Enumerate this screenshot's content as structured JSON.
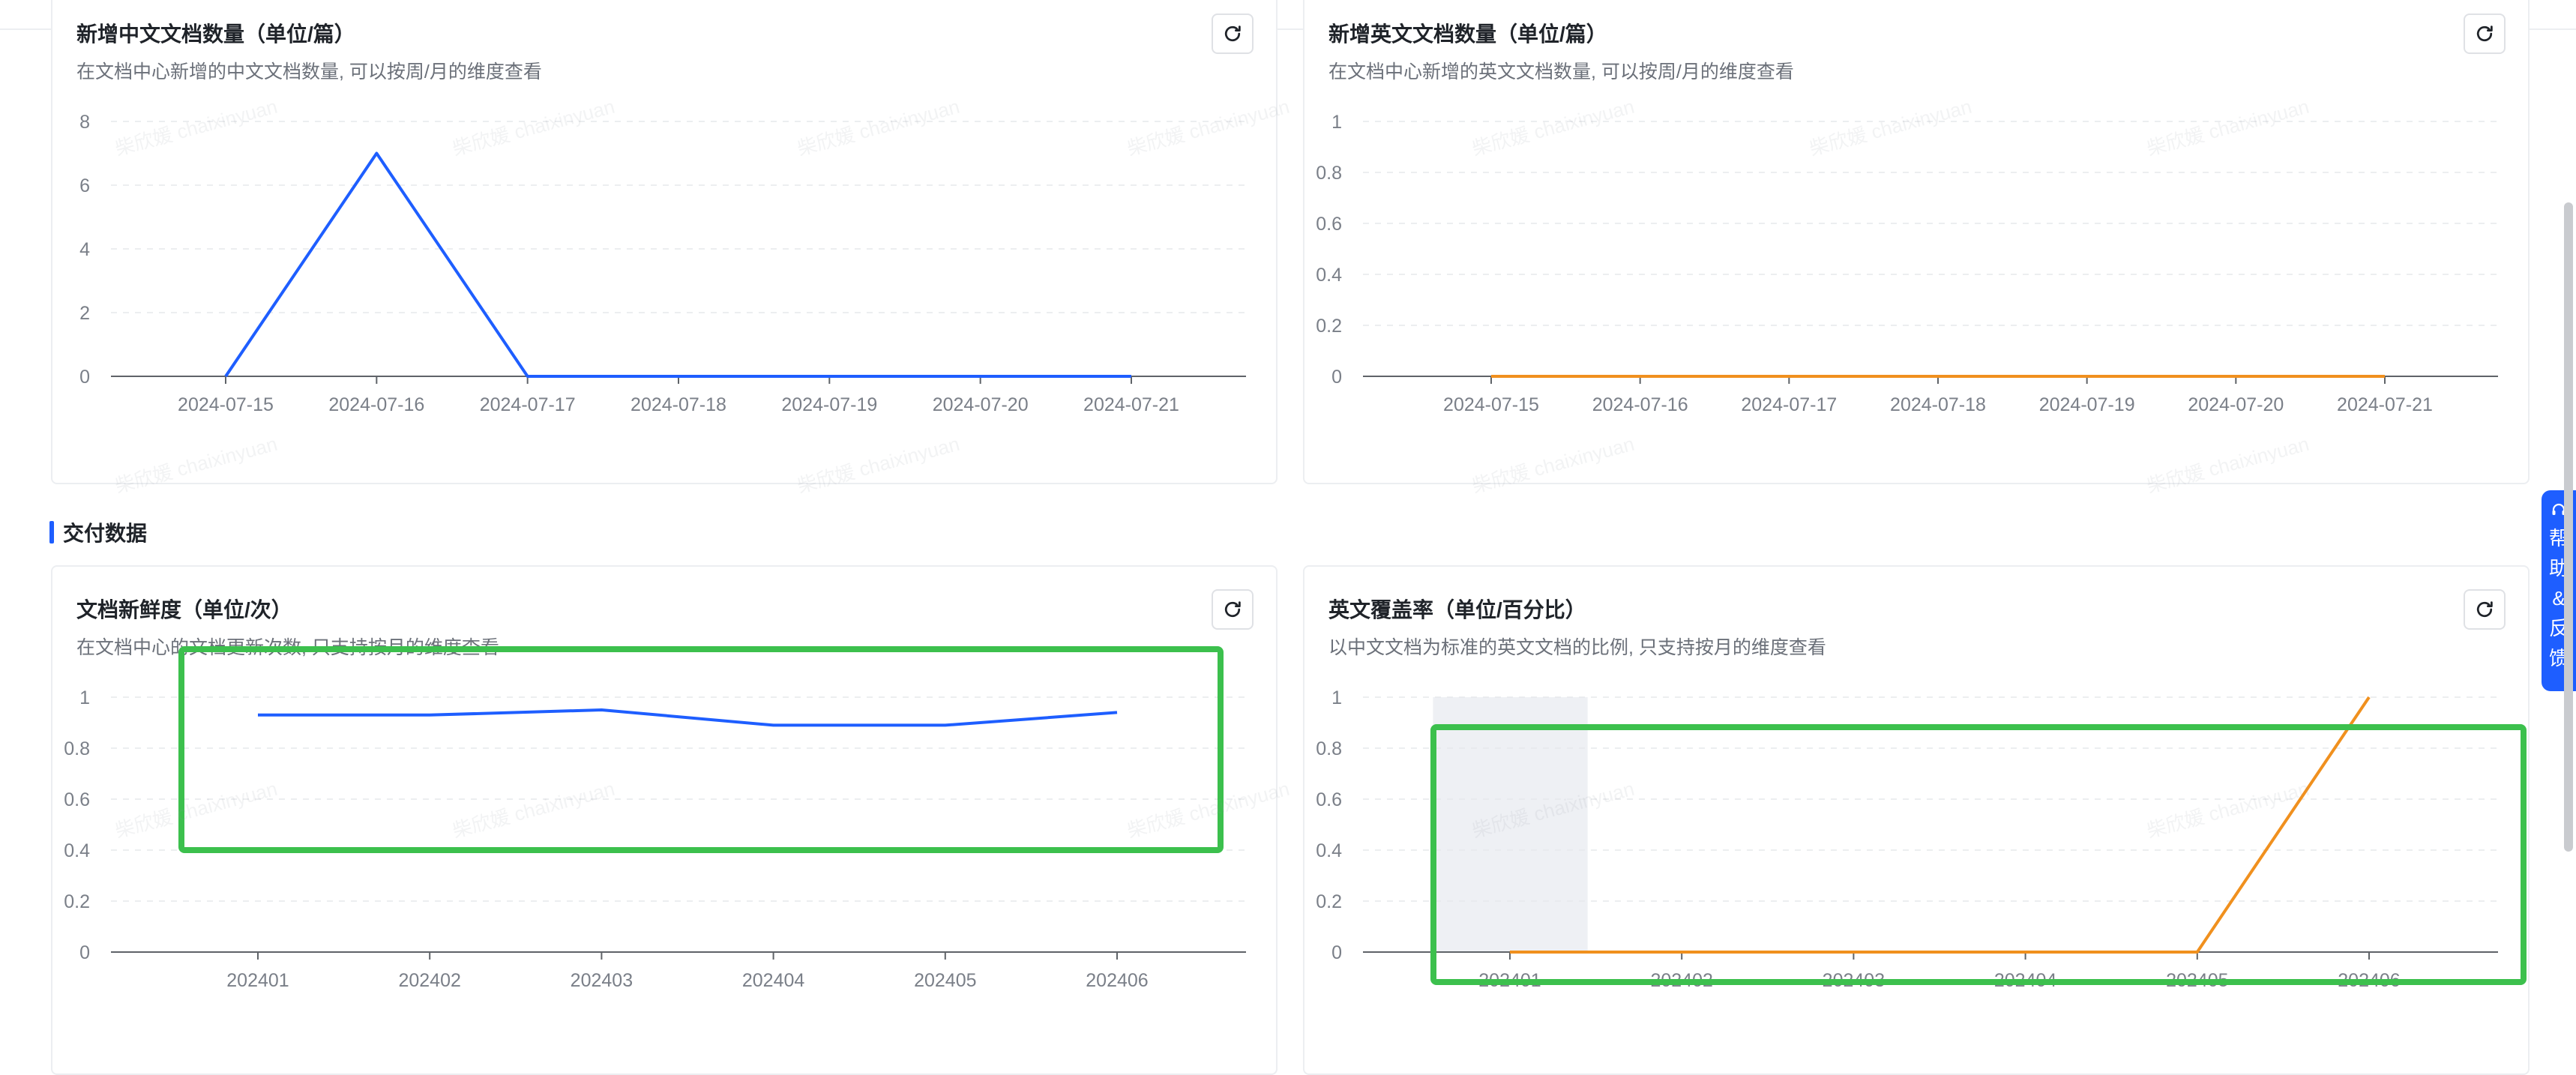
{
  "sections": {
    "delivery_title": "交付数据"
  },
  "help": {
    "label": [
      "帮",
      "助",
      "&",
      "反",
      "馈"
    ]
  },
  "cards": {
    "cn_docs": {
      "title": "新增中文文档数量（单位/篇）",
      "desc": "在文档中心新增的中文文档数量, 可以按周/月的维度查看"
    },
    "en_docs": {
      "title": "新增英文文档数量（单位/篇）",
      "desc": "在文档中心新增的英文文档数量, 可以按周/月的维度查看"
    },
    "freshness": {
      "title": "文档新鲜度（单位/次）",
      "desc": "在文档中心的文档更新次数, 只支持按月的维度查看"
    },
    "en_coverage": {
      "title": "英文覆盖率（单位/百分比）",
      "desc": "以中文文档为标准的英文文档的比例, 只支持按月的维度查看"
    }
  },
  "watermark": "柴欣媛 chaixinyuan",
  "colors": {
    "blue": "#1e5eff",
    "orange": "#f0901e",
    "highlight": "#3cc04d"
  },
  "chart_data": [
    {
      "id": "cn_docs",
      "type": "line",
      "categories": [
        "2024-07-15",
        "2024-07-16",
        "2024-07-17",
        "2024-07-18",
        "2024-07-19",
        "2024-07-20",
        "2024-07-21"
      ],
      "series": [
        {
          "values": [
            0,
            7,
            0,
            0,
            0,
            0,
            0
          ],
          "color": "#1e5eff"
        }
      ],
      "ylim": [
        0,
        8
      ],
      "yticks": [
        0,
        2,
        4,
        6,
        8
      ],
      "grid": true
    },
    {
      "id": "en_docs",
      "type": "line",
      "categories": [
        "2024-07-15",
        "2024-07-16",
        "2024-07-17",
        "2024-07-18",
        "2024-07-19",
        "2024-07-20",
        "2024-07-21"
      ],
      "series": [
        {
          "values": [
            0,
            0,
            0,
            0,
            0,
            0,
            0
          ],
          "color": "#f0901e"
        }
      ],
      "ylim": [
        0,
        1
      ],
      "yticks": [
        0,
        0.2,
        0.4,
        0.6,
        0.8,
        1
      ],
      "grid": true
    },
    {
      "id": "freshness",
      "type": "line",
      "categories": [
        "202401",
        "202402",
        "202403",
        "202404",
        "202405",
        "202406"
      ],
      "series": [
        {
          "values": [
            0.93,
            0.93,
            0.95,
            0.89,
            0.89,
            0.94
          ],
          "color": "#1e5eff"
        }
      ],
      "ylim": [
        0,
        1
      ],
      "yticks": [
        0,
        0.2,
        0.4,
        0.6,
        0.8,
        1
      ],
      "grid": true
    },
    {
      "id": "en_coverage",
      "type": "line",
      "categories": [
        "202401",
        "202402",
        "202403",
        "202404",
        "202405",
        "202406"
      ],
      "series": [
        {
          "values": [
            0,
            0,
            0,
            0,
            0,
            1
          ],
          "color": "#f0901e"
        }
      ],
      "ylim": [
        0,
        1
      ],
      "yticks": [
        0,
        0.2,
        0.4,
        0.6,
        0.8,
        1
      ],
      "grid": true,
      "hover_category": "202401"
    }
  ]
}
